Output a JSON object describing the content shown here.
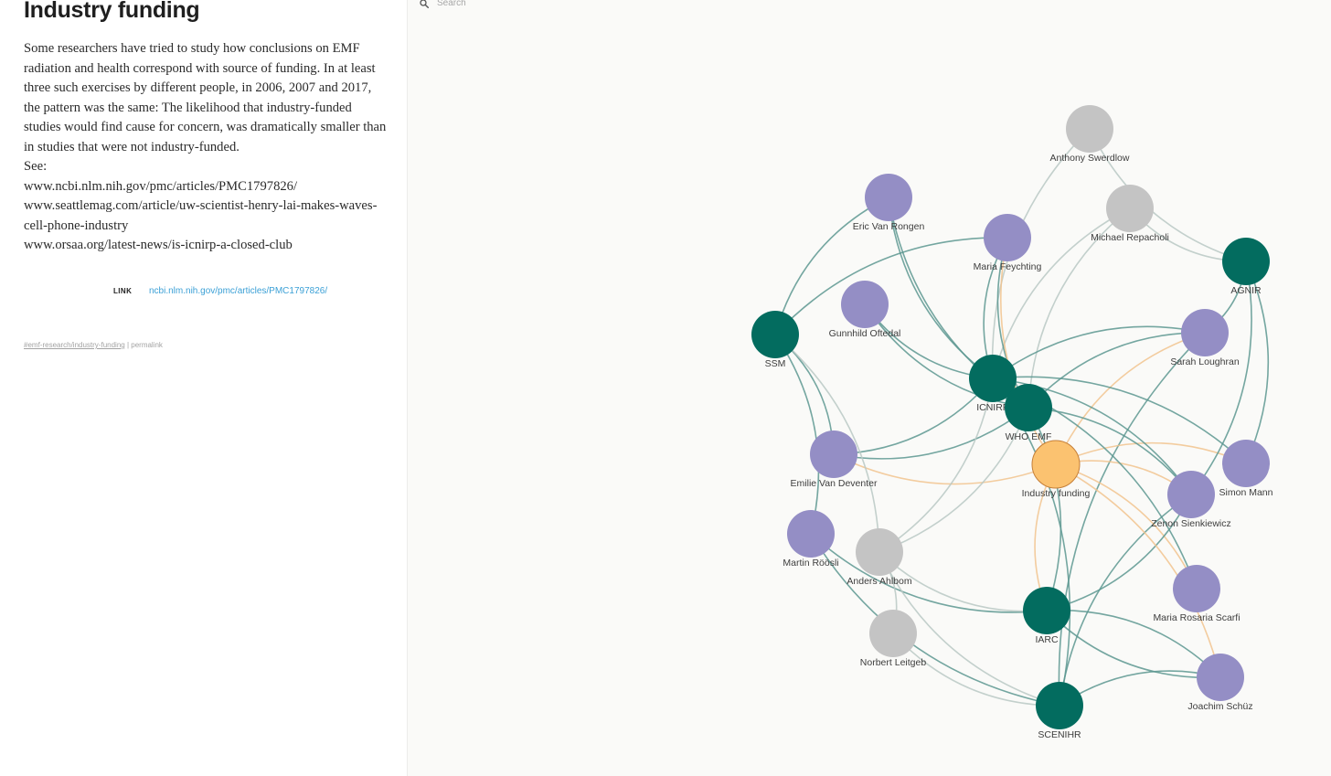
{
  "article": {
    "title": "Industry funding",
    "paragraphs": [
      "Some researchers have tried to study how conclusions on EMF radiation and health correspond with source of funding. In at least three such exercises by different people, in 2006, 2007 and 2017, the pattern was the same: The likelihood that industry-funded studies would find cause for concern, was dramatically smaller than in studies that were not industry-funded.",
      "See:",
      "www.ncbi.nlm.nih.gov/pmc/articles/PMC1797826/",
      "www.seattlemag.com/article/uw-scientist-henry-lai-makes-waves-cell-phone-industry",
      "www.orsaa.org/latest-news/is-icnirp-a-closed-club"
    ],
    "link_label": "LINK",
    "link_url": "ncbi.nlm.nih.gov/pmc/articles/PMC1797826/",
    "tag": "#emf-research/industry-funding",
    "separator": " | ",
    "permalink": "permalink"
  },
  "search": {
    "placeholder": "Search",
    "icon": "search-icon"
  },
  "colors": {
    "organization": "#036c5f",
    "person": "#948ec5",
    "other": "#c4c4c4",
    "focus": "#fbc270",
    "focus_stroke": "#c57f38",
    "edge_org": "#5c9690",
    "edge_person": "#a8a6c9",
    "edge_other": "#b9c8c4",
    "edge_focus": "#f1c38e"
  },
  "graph": {
    "nodes": [
      {
        "id": "anthony-swerdlow",
        "label": "Anthony Swerdlow",
        "type": "other"
      },
      {
        "id": "eric-van-rongen",
        "label": "Eric Van Rongen",
        "type": "person"
      },
      {
        "id": "michael-repacholi",
        "label": "Michael Repacholi",
        "type": "other"
      },
      {
        "id": "maria-feychting",
        "label": "Maria Feychting",
        "type": "person"
      },
      {
        "id": "agnir",
        "label": "AGNIR",
        "type": "organization"
      },
      {
        "id": "gunnhild-oftedal",
        "label": "Gunnhild Oftedal",
        "type": "person"
      },
      {
        "id": "ssm",
        "label": "SSM",
        "type": "organization"
      },
      {
        "id": "sarah-loughran",
        "label": "Sarah Loughran",
        "type": "person"
      },
      {
        "id": "icnirp",
        "label": "ICNIRP",
        "type": "organization"
      },
      {
        "id": "who-emf",
        "label": "WHO EMF",
        "type": "organization"
      },
      {
        "id": "emilie-van-deventer",
        "label": "Emilie Van Deventer",
        "type": "person"
      },
      {
        "id": "industry-funding",
        "label": "Industry funding",
        "type": "focus"
      },
      {
        "id": "simon-mann",
        "label": "Simon Mann",
        "type": "person"
      },
      {
        "id": "zenon-sienkiewicz",
        "label": "Zenon Sienkiewicz",
        "type": "person"
      },
      {
        "id": "martin-roosli",
        "label": "Martin Röösli",
        "type": "person"
      },
      {
        "id": "anders-ahlbom",
        "label": "Anders Ahlbom",
        "type": "other"
      },
      {
        "id": "maria-rosaria-scarfi",
        "label": "Maria Rosaria Scarfi",
        "type": "person"
      },
      {
        "id": "iarc",
        "label": "IARC",
        "type": "organization"
      },
      {
        "id": "norbert-leitgeb",
        "label": "Norbert Leitgeb",
        "type": "other"
      },
      {
        "id": "joachim-schuz",
        "label": "Joachim Schüz",
        "type": "person"
      },
      {
        "id": "scenihr",
        "label": "SCENIHR",
        "type": "organization"
      }
    ],
    "edges": [
      [
        "anthony-swerdlow",
        "agnir"
      ],
      [
        "anthony-swerdlow",
        "icnirp"
      ],
      [
        "eric-van-rongen",
        "icnirp"
      ],
      [
        "eric-van-rongen",
        "who-emf"
      ],
      [
        "eric-van-rongen",
        "ssm"
      ],
      [
        "michael-repacholi",
        "icnirp"
      ],
      [
        "michael-repacholi",
        "who-emf"
      ],
      [
        "michael-repacholi",
        "agnir"
      ],
      [
        "maria-feychting",
        "icnirp"
      ],
      [
        "maria-feychting",
        "who-emf"
      ],
      [
        "maria-feychting",
        "industry-funding"
      ],
      [
        "maria-feychting",
        "ssm"
      ],
      [
        "gunnhild-oftedal",
        "icnirp"
      ],
      [
        "gunnhild-oftedal",
        "who-emf"
      ],
      [
        "sarah-loughran",
        "icnirp"
      ],
      [
        "sarah-loughran",
        "agnir"
      ],
      [
        "sarah-loughran",
        "who-emf"
      ],
      [
        "sarah-loughran",
        "industry-funding"
      ],
      [
        "sarah-loughran",
        "scenihr"
      ],
      [
        "emilie-van-deventer",
        "who-emf"
      ],
      [
        "emilie-van-deventer",
        "icnirp"
      ],
      [
        "emilie-van-deventer",
        "ssm"
      ],
      [
        "emilie-van-deventer",
        "industry-funding"
      ],
      [
        "simon-mann",
        "agnir"
      ],
      [
        "simon-mann",
        "icnirp"
      ],
      [
        "simon-mann",
        "industry-funding"
      ],
      [
        "zenon-sienkiewicz",
        "agnir"
      ],
      [
        "zenon-sienkiewicz",
        "icnirp"
      ],
      [
        "zenon-sienkiewicz",
        "who-emf"
      ],
      [
        "zenon-sienkiewicz",
        "industry-funding"
      ],
      [
        "zenon-sienkiewicz",
        "scenihr"
      ],
      [
        "martin-roosli",
        "ssm"
      ],
      [
        "martin-roosli",
        "scenihr"
      ],
      [
        "martin-roosli",
        "iarc"
      ],
      [
        "anders-ahlbom",
        "icnirp"
      ],
      [
        "anders-ahlbom",
        "who-emf"
      ],
      [
        "anders-ahlbom",
        "iarc"
      ],
      [
        "anders-ahlbom",
        "ssm"
      ],
      [
        "anders-ahlbom",
        "scenihr"
      ],
      [
        "maria-rosaria-scarfi",
        "icnirp"
      ],
      [
        "maria-rosaria-scarfi",
        "industry-funding"
      ],
      [
        "iarc",
        "who-emf"
      ],
      [
        "iarc",
        "joachim-schuz"
      ],
      [
        "iarc",
        "zenon-sienkiewicz"
      ],
      [
        "norbert-leitgeb",
        "scenihr"
      ],
      [
        "norbert-leitgeb",
        "anders-ahlbom"
      ],
      [
        "joachim-schuz",
        "scenihr"
      ],
      [
        "joachim-schuz",
        "industry-funding"
      ],
      [
        "joachim-schuz",
        "iarc"
      ],
      [
        "scenihr",
        "icnirp"
      ],
      [
        "industry-funding",
        "iarc"
      ]
    ]
  }
}
